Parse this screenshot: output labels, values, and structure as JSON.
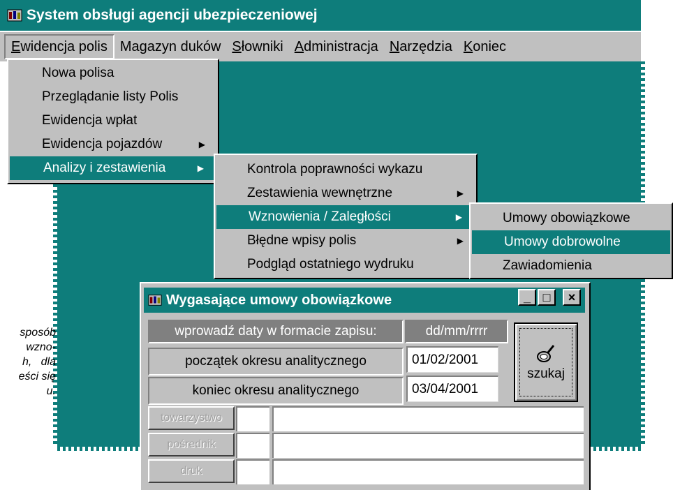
{
  "app": {
    "title": "System obsługi agencji ubezpieczeniowej"
  },
  "menubar": {
    "items": [
      {
        "pre": "",
        "mn": "E",
        "post": "widencja polis"
      },
      {
        "pre": "Magazyn duków",
        "mn": "",
        "post": ""
      },
      {
        "pre": "",
        "mn": "S",
        "post": "łowniki"
      },
      {
        "pre": "",
        "mn": "A",
        "post": "dministracja"
      },
      {
        "pre": "",
        "mn": "N",
        "post": "arzędzia"
      },
      {
        "pre": "",
        "mn": "K",
        "post": "oniec"
      }
    ]
  },
  "menu1": {
    "items": [
      "Nowa polisa",
      "Przeglądanie listy Polis",
      "Ewidencja wpłat",
      "Ewidencja pojazdów",
      "Analizy i zestawienia"
    ]
  },
  "menu2": {
    "items": [
      "Kontrola poprawności wykazu",
      "Zestawienia wewnętrzne",
      "Wznowienia / Zaległości",
      "Błędne wpisy polis",
      "Podgląd ostatniego wydruku"
    ]
  },
  "menu3": {
    "items": [
      "Umowy obowiązkowe",
      "Umowy dobrowolne",
      "Zawiadomienia"
    ]
  },
  "side_note": "sposób\nwzno-\nh,   dla\neści się\nu.",
  "dialog": {
    "title": "Wygasające umowy obowiązkowe",
    "header_label": "wprowadź daty w formacie zapisu:",
    "header_format": "dd/mm/rrrr",
    "start_label": "początek okresu analitycznego",
    "start_value": "01/02/2001",
    "end_label": "koniec okresu analitycznego",
    "end_value": "03/04/2001",
    "search_label": "szukaj",
    "btn_towarzystwo": "towarzystwo",
    "btn_posrednik": "pośrednik",
    "btn_druk": "druk",
    "minimize": "_",
    "maximize": "□",
    "close": "×"
  },
  "colors": {
    "accent": "#0e7d7b",
    "face": "#c0c0c0"
  }
}
